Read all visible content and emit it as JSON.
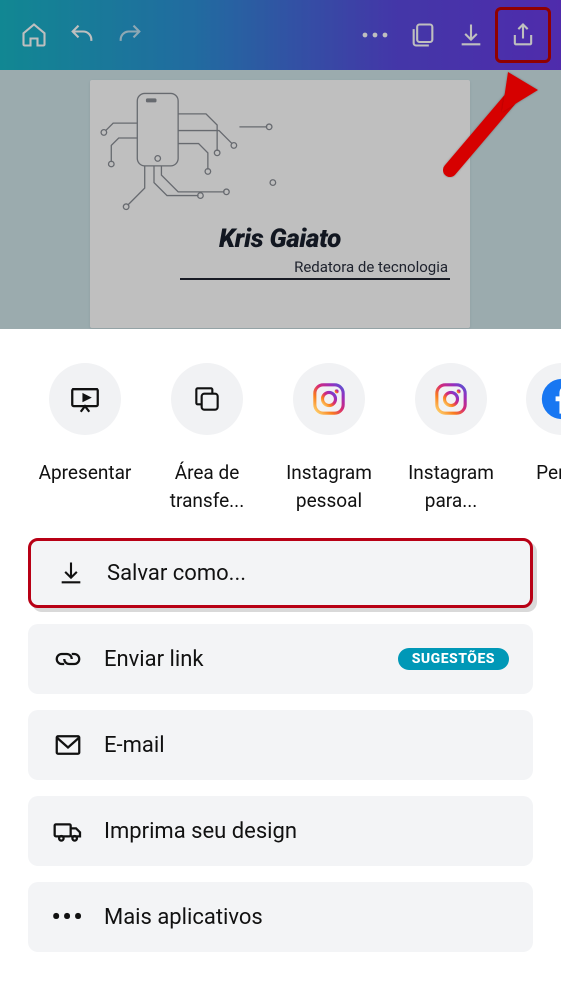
{
  "toolbar": {
    "icons": {
      "home": "home-icon",
      "undo": "undo-icon",
      "redo": "redo-icon",
      "more": "more-icon",
      "pages": "pages-icon",
      "download": "download-icon",
      "share": "share-icon"
    }
  },
  "card": {
    "name": "Kris Gaiato",
    "role": "Redatora de tecnologia"
  },
  "share_targets": [
    {
      "key": "present",
      "label": "Apresentar"
    },
    {
      "key": "clipboard",
      "label": "Área de transfe..."
    },
    {
      "key": "instagram_personal",
      "label": "Instagram pessoal"
    },
    {
      "key": "instagram_for",
      "label": "Instagram para..."
    },
    {
      "key": "facebook_profile",
      "label": "Per Face"
    }
  ],
  "options": {
    "save_as": "Salvar como...",
    "send_link": "Enviar link",
    "send_link_badge": "SUGESTÕES",
    "email": "E-mail",
    "print": "Imprima seu design",
    "more_apps": "Mais aplicativos"
  },
  "annotation": {
    "share_highlighted": true,
    "save_as_highlighted": true
  },
  "colors": {
    "instagram_stop1": "#feda75",
    "instagram_stop2": "#fa7e1e",
    "instagram_stop3": "#d62976",
    "instagram_stop4": "#962fbf",
    "instagram_stop5": "#4f5bd5",
    "facebook": "#1877F2",
    "badge": "#0098b7",
    "highlight_red": "#b80015"
  }
}
